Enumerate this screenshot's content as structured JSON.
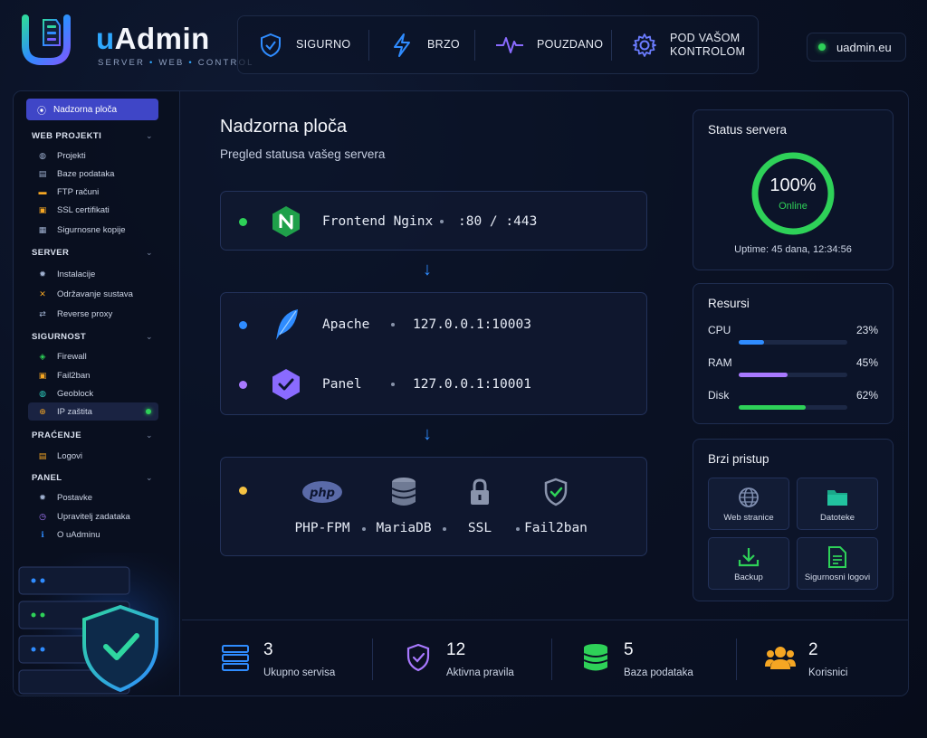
{
  "brand": {
    "name_u": "u",
    "name_rest": "Admin",
    "tagline_1": "SERVER",
    "tagline_2": "WEB",
    "tagline_3": "CONTROL",
    "accent": "#2fa8ff"
  },
  "features": [
    {
      "label_1": "SIGURNO",
      "label_2": "",
      "icon": "shield-check-icon"
    },
    {
      "label_1": "BRZO",
      "label_2": "",
      "icon": "lightning-icon"
    },
    {
      "label_1": "POUZDANO",
      "label_2": "",
      "icon": "pulse-icon"
    },
    {
      "label_1": "POD VAŠOM",
      "label_2": "KONTROLOM",
      "icon": "gear-icon"
    }
  ],
  "domain": "uadmin.eu",
  "sidebar": {
    "active": {
      "label": "Nadzorna ploča",
      "icon": "dashboard-icon"
    },
    "groups": [
      {
        "title": "WEB PROJEKTI",
        "items": [
          {
            "label": "Projekti",
            "icon": "globe-icon"
          },
          {
            "label": "Baze podataka",
            "icon": "database-icon"
          },
          {
            "label": "FTP računi",
            "icon": "folder-icon"
          },
          {
            "label": "SSL certifikati",
            "icon": "lock-icon"
          },
          {
            "label": "Sigurnosne kopije",
            "icon": "backup-icon"
          }
        ]
      },
      {
        "title": "SERVER",
        "items": [
          {
            "label": "Instalacije",
            "icon": "gear-icon"
          },
          {
            "label": "Održavanje sustava",
            "icon": "tools-icon"
          },
          {
            "label": "Reverse proxy",
            "icon": "swap-icon"
          }
        ]
      },
      {
        "title": "SIGURNOST",
        "items": [
          {
            "label": "Firewall",
            "icon": "shield-icon"
          },
          {
            "label": "Fail2ban",
            "icon": "lock-icon"
          },
          {
            "label": "Geoblock",
            "icon": "globe-icon"
          },
          {
            "label": "IP zaštita",
            "icon": "target-icon"
          }
        ]
      },
      {
        "title": "PRAĆENJE",
        "items": [
          {
            "label": "Logovi",
            "icon": "log-icon"
          }
        ]
      },
      {
        "title": "PANEL",
        "items": [
          {
            "label": "Postavke",
            "icon": "gear-icon"
          },
          {
            "label": "Upravitelj zadataka",
            "icon": "clock-icon"
          },
          {
            "label": "O uAdminu",
            "icon": "info-icon"
          }
        ]
      }
    ]
  },
  "page": {
    "title": "Nadzorna ploča",
    "subtitle": "Pregled statusa vašeg servera"
  },
  "flow": {
    "frontend": {
      "name": "Frontend Nginx",
      "addr": ":80 / :443",
      "dot": "#2ed158"
    },
    "apache": {
      "name": "Apache",
      "addr": "127.0.0.1:10003",
      "dot": "#2f8cff"
    },
    "panel": {
      "name": "Panel",
      "addr": "127.0.0.1:10001",
      "dot": "#a879ff"
    },
    "stack_dot": "#f5c242",
    "stack": [
      {
        "label": "PHP-FPM",
        "icon": "php-icon"
      },
      {
        "label": "MariaDB",
        "icon": "database-icon"
      },
      {
        "label": "SSL",
        "icon": "lock-icon"
      },
      {
        "label": "Fail2ban",
        "icon": "shield-check-icon"
      }
    ]
  },
  "status": {
    "title": "Status servera",
    "value": "100%",
    "state": "Online",
    "uptime": "Uptime: 45 dana, 12:34:56",
    "level": 1.0,
    "color": "#2ed158"
  },
  "resources": {
    "title": "Resursi",
    "items": [
      {
        "label": "CPU",
        "value": "23%",
        "level": 0.23,
        "color": "#2f8cff"
      },
      {
        "label": "RAM",
        "value": "45%",
        "level": 0.45,
        "color": "#a879ff"
      },
      {
        "label": "Disk",
        "value": "62%",
        "level": 0.62,
        "color": "#2ed158"
      }
    ]
  },
  "quick": {
    "title": "Brzi pristup",
    "items": [
      {
        "label": "Web stranice",
        "icon": "globe-icon"
      },
      {
        "label": "Datoteke",
        "icon": "folder-icon"
      },
      {
        "label": "Backup",
        "icon": "download-icon"
      },
      {
        "label": "Sigurnosni logovi",
        "icon": "log-icon"
      }
    ]
  },
  "stats": [
    {
      "value": "3",
      "label": "Ukupno servisa",
      "icon": "server-icon",
      "color": "#2f8cff"
    },
    {
      "value": "12",
      "label": "Aktivna pravila",
      "icon": "shield-check-icon",
      "color": "#a879ff"
    },
    {
      "value": "5",
      "label": "Baza podataka",
      "icon": "database-icon",
      "color": "#2ed158"
    },
    {
      "value": "2",
      "label": "Korisnici",
      "icon": "users-icon",
      "color": "#f5a623"
    }
  ]
}
